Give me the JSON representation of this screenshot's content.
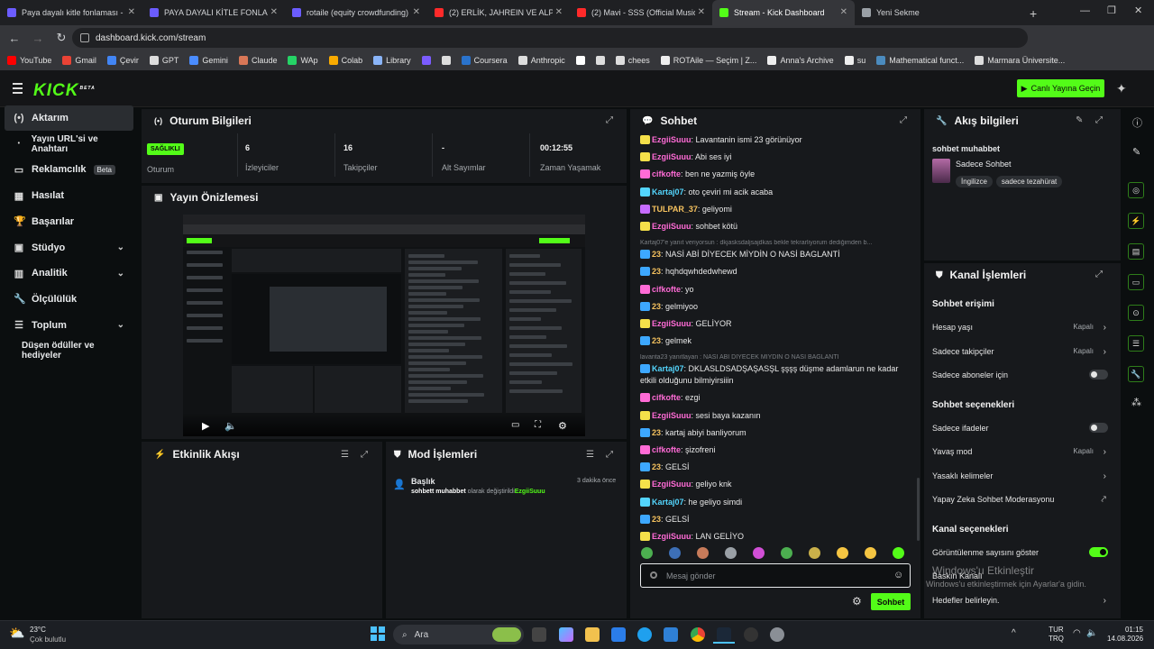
{
  "browser": {
    "tabs": [
      {
        "title": "Paya dayalı kitle fonlaması - Kit",
        "color": "#6b5cff"
      },
      {
        "title": "PAYA DAYALI KİTLE FONLAMAS",
        "color": "#6b5cff"
      },
      {
        "title": "rotaile (equity crowdfunding)",
        "color": "#6b5cff"
      },
      {
        "title": "(2) ERLİK, JAHREIN VE ALPER Ç",
        "color": "#ff2a2a"
      },
      {
        "title": "(2) Mavi - SSS (Official Music V",
        "color": "#ff2a2a"
      },
      {
        "title": "Stream - Kick Dashboard",
        "color": "#53fc18"
      },
      {
        "title": "Yeni Sekme",
        "color": "#9aa0a6"
      }
    ],
    "url": "dashboard.kick.com/stream",
    "bookmarks": [
      {
        "label": "YouTube",
        "color": "#ff0000"
      },
      {
        "label": "Gmail",
        "color": "#ea4335"
      },
      {
        "label": "Çevir",
        "color": "#4285f4"
      },
      {
        "label": "GPT",
        "color": "#dddddd"
      },
      {
        "label": "Gemini",
        "color": "#4a8cff"
      },
      {
        "label": "Claude",
        "color": "#d97757"
      },
      {
        "label": "WAp",
        "color": "#25d366"
      },
      {
        "label": "Colab",
        "color": "#f9ab00"
      },
      {
        "label": "Library",
        "color": "#8ab4f8"
      },
      {
        "label": "",
        "color": "#7b5cff"
      },
      {
        "label": "",
        "color": "#dddddd"
      },
      {
        "label": "Coursera",
        "color": "#2a73cc"
      },
      {
        "label": "Anthropic",
        "color": "#dddddd"
      },
      {
        "label": "",
        "color": "#ffffff"
      },
      {
        "label": "",
        "color": "#dddddd"
      },
      {
        "label": "chees",
        "color": "#dddddd"
      },
      {
        "label": "ROTAile — Seçim | Z...",
        "color": "#eeeeee"
      },
      {
        "label": "Anna's Archive",
        "color": "#eeeeee"
      },
      {
        "label": "su",
        "color": "#eeeeee"
      },
      {
        "label": "Mathematical funct...",
        "color": "#4b8bbe"
      },
      {
        "label": "Marmara Üniversite...",
        "color": "#dddddd"
      }
    ]
  },
  "header": {
    "logo": "KICK",
    "logo_tag": "BETA",
    "live_button": "Canlı Yayına Geçin",
    "accent": "#53fc18"
  },
  "sidebar": {
    "items": [
      {
        "label": "Aktarım",
        "icon": "broadcast-icon"
      },
      {
        "label": "Yayın URL'si ve Anahtarı",
        "icon": "key-dot-icon"
      },
      {
        "label": "Reklamcılık",
        "icon": "ad-icon",
        "badge": "Beta"
      },
      {
        "label": "Hasılat",
        "icon": "revenue-icon"
      },
      {
        "label": "Başarılar",
        "icon": "trophy-icon"
      },
      {
        "label": "Stüdyo",
        "icon": "studio-icon"
      },
      {
        "label": "Analitik",
        "icon": "chart-icon"
      },
      {
        "label": "Ölçülülük",
        "icon": "wrench-icon"
      },
      {
        "label": "Toplum",
        "icon": "community-icon"
      },
      {
        "label": "Düşen ödüller ve hediyeler",
        "icon": ""
      }
    ]
  },
  "session": {
    "title": "Oturum Bilgileri",
    "stats": [
      {
        "value": "SAĞLIKLI",
        "label": "Oturum"
      },
      {
        "value": "6",
        "label": "İzleyiciler"
      },
      {
        "value": "16",
        "label": "Takipçiler"
      },
      {
        "value": "-",
        "label": "Alt Sayımlar"
      },
      {
        "value": "00:12:55",
        "label": "Zaman Yaşamak"
      }
    ]
  },
  "preview": {
    "title": "Yayın Önizlemesi"
  },
  "activity": {
    "title": "Etkinlik Akışı"
  },
  "mod": {
    "title": "Mod İşlemleri",
    "entry": {
      "heading": "Başlık",
      "time": "3 dakika önce",
      "text_bold": "sohbett muhabbet",
      "text_mid": " olarak değiştirildi",
      "user": "EzgiiSuuu"
    }
  },
  "chat": {
    "title": "Sohbet",
    "messages": [
      {
        "user": "EzgiiSuuu",
        "color": "#ff6bd6",
        "badge": "#f5e04a",
        "text": "Lavantanin ismi 23 görünüyor"
      },
      {
        "user": "EzgiiSuuu",
        "color": "#ff6bd6",
        "badge": "#f5e04a",
        "text": "Abi ses iyi"
      },
      {
        "user": "cifkofte",
        "color": "#ff6bd6",
        "badge": "#ff6bd6",
        "text": "ben ne yazmiş öyle"
      },
      {
        "user": "Kartaj07",
        "color": "#53d5fd",
        "badge": "#53d5fd",
        "text": "oto çeviri mi acik acaba"
      },
      {
        "user": "TULPAR_37",
        "color": "#f7c35f",
        "badge": "#c66bff",
        "text": "geliyomi"
      },
      {
        "user": "EzgiiSuuu",
        "color": "#ff6bd6",
        "badge": "#f5e04a",
        "text": "sohbet kötü"
      },
      {
        "reply": "Kartaj07'e yanıt veriyorsun : dkjasksdaljsajdkas bekle tekrarliyorum dediğimden b..."
      },
      {
        "user": "23",
        "color": "#f7c35f",
        "badge": "#3da8ff",
        "text": "NASİ ABİ DİYECEK MİYDİN O NASİ BAGLANTİ"
      },
      {
        "user": "23",
        "color": "#f7c35f",
        "badge": "#3da8ff",
        "text": "hqhdqwhdedwhewd"
      },
      {
        "user": "cifkofte",
        "color": "#ff6bd6",
        "badge": "#ff6bd6",
        "text": "yo"
      },
      {
        "user": "23",
        "color": "#f7c35f",
        "badge": "#3da8ff",
        "text": "gelmiyoo"
      },
      {
        "user": "EzgiiSuuu",
        "color": "#ff6bd6",
        "badge": "#f5e04a",
        "text": "GELİYOR"
      },
      {
        "user": "23",
        "color": "#f7c35f",
        "badge": "#3da8ff",
        "text": "gelmek"
      },
      {
        "reply": "lavanta23 yanıtlayan : NASİ ABİ DİYECEK MİYDİN O NASİ BAGLANTİ"
      },
      {
        "user": "Kartaj07",
        "color": "#53d5fd",
        "badge": "#3da8ff",
        "text": "DKLASLDSADŞAŞASŞL şşşş düşme adamlarun ne kadar etkili olduğunu bilmiyirsiiin"
      },
      {
        "user": "cifkofte",
        "color": "#ff6bd6",
        "badge": "#ff6bd6",
        "text": "ezgi"
      },
      {
        "user": "EzgiiSuuu",
        "color": "#ff6bd6",
        "badge": "#f5e04a",
        "text": "sesi baya kazanın"
      },
      {
        "user": "23",
        "color": "#f7c35f",
        "badge": "#3da8ff",
        "text": "kartaj abiyi banliyorum"
      },
      {
        "user": "cifkofte",
        "color": "#ff6bd6",
        "badge": "#ff6bd6",
        "text": "şizofreni"
      },
      {
        "user": "23",
        "color": "#f7c35f",
        "badge": "#3da8ff",
        "text": "GELSİ"
      },
      {
        "user": "EzgiiSuuu",
        "color": "#ff6bd6",
        "badge": "#f5e04a",
        "text": "geliyo knk"
      },
      {
        "user": "Kartaj07",
        "color": "#53d5fd",
        "badge": "#53d5fd",
        "text": "he geliyo simdi"
      },
      {
        "user": "23",
        "color": "#f7c35f",
        "badge": "#3da8ff",
        "text": "GELSİ"
      },
      {
        "user": "EzgiiSuuu",
        "color": "#ff6bd6",
        "badge": "#f5e04a",
        "text": "LAN GELİYO"
      }
    ],
    "emote_colors": [
      "#4caf50",
      "#3d6fb6",
      "#c77b5a",
      "#9aa0a6",
      "#d14fd6",
      "#4caf50",
      "#c9b04a",
      "#f5c542",
      "#f5c542",
      "#53fc18"
    ],
    "input_placeholder": "Mesaj gönder",
    "send_label": "Sohbet"
  },
  "stream_info": {
    "title": "Akış bilgileri",
    "stream_title": "sohbet muhabbet",
    "category": "Sadece Sohbet",
    "tags": [
      "İngilizce",
      "sadece tezahürat"
    ]
  },
  "channel_actions": {
    "title": "Kanal İşlemleri",
    "sections": [
      {
        "heading": "Sohbet erişimi",
        "options": [
          {
            "label": "Hesap yaşı",
            "value": "Kapalı",
            "kind": "chevron"
          },
          {
            "label": "Sadece takipçiler",
            "value": "Kapalı",
            "kind": "chevron"
          },
          {
            "label": "Sadece aboneler için",
            "value": "",
            "kind": "toggle",
            "on": false
          }
        ]
      },
      {
        "heading": "Sohbet seçenekleri",
        "options": [
          {
            "label": "Sadece ifadeler",
            "value": "",
            "kind": "toggle",
            "on": false
          },
          {
            "label": "Yavaş mod",
            "value": "Kapalı",
            "kind": "chevron"
          },
          {
            "label": "Yasaklı kelimeler",
            "value": "",
            "kind": "chevron"
          },
          {
            "label": "Yapay Zeka Sohbet Moderasyonu",
            "value": "",
            "kind": "external"
          }
        ]
      },
      {
        "heading": "Kanal seçenekleri",
        "options": [
          {
            "label": "Görüntülenme sayısını göster",
            "value": "",
            "kind": "toggle",
            "on": true
          },
          {
            "label": "Baskın Kanalı",
            "value": "",
            "kind": "none"
          },
          {
            "label": "Hedefler belirleyin.",
            "value": "",
            "kind": "chevron"
          }
        ]
      }
    ]
  },
  "watermark": {
    "line1": "Windows'u Etkinleştir",
    "line2": "Windows'u etkinleştirmek için Ayarlar'a gidin."
  },
  "taskbar": {
    "weather_temp": "23°C",
    "weather_desc": "Çok bulutlu",
    "search_label": "Ara",
    "lang1": "TUR",
    "lang2": "TRQ",
    "time": "01:15",
    "date": "14.08.2026"
  }
}
